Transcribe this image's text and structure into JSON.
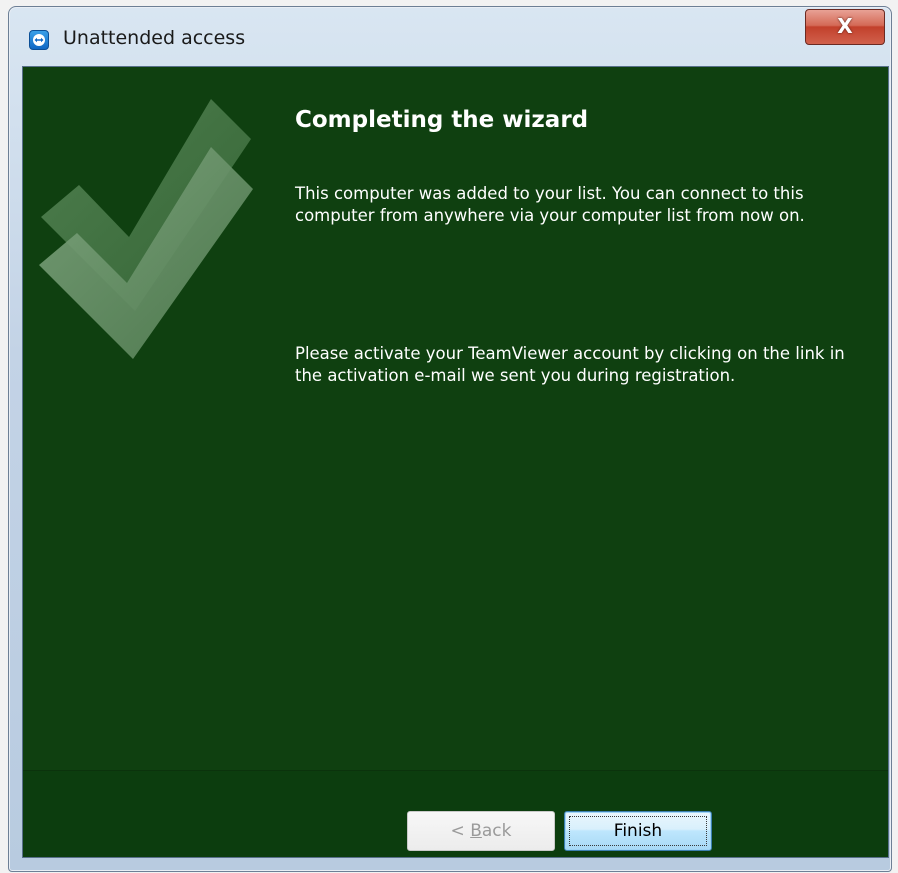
{
  "window": {
    "title": "Unattended access",
    "close_label": "X"
  },
  "wizard": {
    "heading": "Completing the wizard",
    "paragraph_1": "This computer was added to your list. You can connect to this computer from anywhere via your computer list from now on.",
    "paragraph_2": "Please activate your TeamViewer account by clicking on the link in the activation e-mail we sent you during registration."
  },
  "buttons": {
    "back_prefix": "< ",
    "back_mnemonic": "B",
    "back_rest": "ack",
    "finish_label": "Finish"
  },
  "colors": {
    "background_green": "#0f4010",
    "finish_button_border": "#3c7fb1"
  },
  "icons": {
    "app": "teamviewer-icon",
    "hero": "checkmark-icon"
  }
}
